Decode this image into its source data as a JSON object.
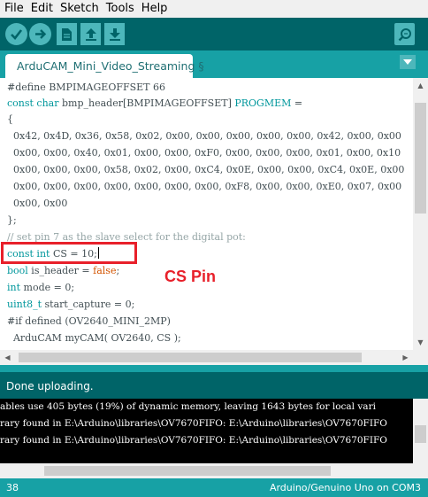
{
  "menu": [
    "File",
    "Edit",
    "Sketch",
    "Tools",
    "Help"
  ],
  "toolbar": {
    "buttons": [
      "verify-icon",
      "upload-icon",
      "new-icon",
      "open-icon",
      "save-icon",
      "serial-monitor-icon"
    ],
    "bg_color": "#006468",
    "button_color": "#4db7bb"
  },
  "tab": {
    "label": "ArduCAM_Mini_Video_Streaming §"
  },
  "code": {
    "line1": "#define BMPIMAGEOFFSET 66",
    "line2_kw": "const char",
    "line2_rest": " bmp_header[BMPIMAGEOFFSET] ",
    "line2_progmem": "PROGMEM",
    "line2_end": " =",
    "line3": "{",
    "line4": "  0x42, 0x4D, 0x36, 0x58, 0x02, 0x00, 0x00, 0x00, 0x00, 0x00, 0x42, 0x00, 0x00",
    "line5": "  0x00, 0x00, 0x40, 0x01, 0x00, 0x00, 0xF0, 0x00, 0x00, 0x00, 0x01, 0x00, 0x10",
    "line6": "  0x00, 0x00, 0x00, 0x58, 0x02, 0x00, 0xC4, 0x0E, 0x00, 0x00, 0xC4, 0x0E, 0x00",
    "line7": "  0x00, 0x00, 0x00, 0x00, 0x00, 0x00, 0x00, 0xF8, 0x00, 0x00, 0xE0, 0x07, 0x00",
    "line8": "  0x00, 0x00",
    "line9": "};",
    "line10": "// set pin 7 as the slave select for the digital pot:",
    "line11_kw": "const int",
    "line11_rest": " CS = 10;",
    "line12_kw": "bool",
    "line12_mid": " is_header = ",
    "line12_val": "false",
    "line12_end": ";",
    "line13_kw": "int",
    "line13_rest": " mode = 0;",
    "line14_kw": "uint8_t",
    "line14_rest": " start_capture = 0;",
    "line15": "#if defined (OV2640_MINI_2MP)",
    "line16": "  ArduCAM myCAM( OV2640, CS );"
  },
  "annotation": {
    "label": "CS Pin",
    "color": "#e8202a"
  },
  "status": {
    "message": "Done uploading."
  },
  "console": {
    "line1": "ables use 405 bytes (19%) of dynamic memory, leaving 1643 bytes for local vari",
    "line2": "rary found in E:\\Arduino\\libraries\\OV7670FIFO: E:\\Arduino\\libraries\\OV7670FIFO",
    "line3": "rary found in E:\\Arduino\\libraries\\OV7670FIFO: E:\\Arduino\\libraries\\OV7670FIFO"
  },
  "footer": {
    "line_number": "38",
    "board": "Arduino/Genuino Uno on COM3"
  }
}
